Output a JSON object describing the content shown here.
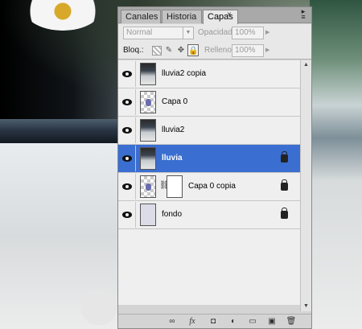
{
  "panel": {
    "tabs": [
      {
        "label": "Canales"
      },
      {
        "label": "Historia"
      },
      {
        "label": "Capas"
      }
    ],
    "active_tab": "Capas",
    "close_glyph": "×",
    "blend_mode": "Normal",
    "opacity_label": "Opacidad:",
    "opacity_value": "100%",
    "lock_label": "Bloq.:",
    "fill_label": "Relleno:",
    "fill_value": "100%",
    "layers": [
      {
        "name": "lluvia2 copia",
        "thumb": "photo",
        "visible": true,
        "locked": false,
        "selected": false
      },
      {
        "name": "Capa 0",
        "thumb": "checker",
        "visible": true,
        "locked": false,
        "selected": false
      },
      {
        "name": "lluvia2",
        "thumb": "photo",
        "visible": true,
        "locked": false,
        "selected": false
      },
      {
        "name": "lluvia",
        "thumb": "photo",
        "visible": true,
        "locked": true,
        "selected": true
      },
      {
        "name": "Capa 0 copia",
        "thumb": "checker",
        "visible": true,
        "locked": true,
        "selected": false,
        "has_mask": true
      },
      {
        "name": "fondo",
        "thumb": "plain",
        "visible": true,
        "locked": true,
        "selected": false
      }
    ],
    "footer_icons": [
      "link-icon",
      "fx-icon",
      "mask-icon",
      "adjustment-icon",
      "folder-icon",
      "new-layer-icon",
      "trash-icon"
    ],
    "footer_glyphs": {
      "link": "∞",
      "fx": "fx",
      "mask": "◘",
      "adjust": "◐",
      "folder": "▭",
      "new": "▣",
      "trash": "🗑"
    }
  },
  "colors": {
    "selection": "#3a6ed0",
    "panel_bg": "#d4d4d4"
  }
}
